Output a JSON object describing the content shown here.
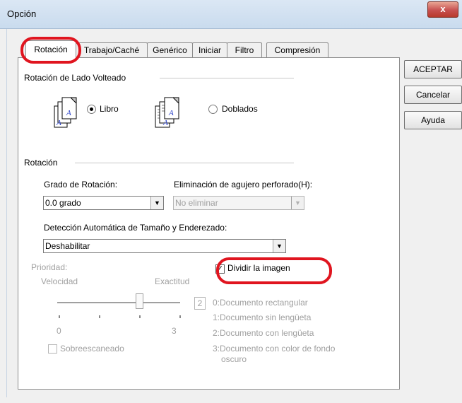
{
  "window": {
    "title": "Opción",
    "close_glyph": "x"
  },
  "tabs": [
    {
      "label": "Rotación",
      "active": true
    },
    {
      "label": "Trabajo/Caché",
      "active": false
    },
    {
      "label": "Genérico",
      "active": false
    },
    {
      "label": "Iniciar",
      "active": false
    },
    {
      "label": "Filtro",
      "active": false
    },
    {
      "label": "Compresión",
      "active": false
    }
  ],
  "buttons": {
    "ok": "ACEPTAR",
    "cancel": "Cancelar",
    "help": "Ayuda"
  },
  "flip_group": {
    "title": "Rotación de Lado Volteado",
    "book_label": "Libro",
    "folded_label": "Doblados",
    "selected": "book"
  },
  "rotation_group": {
    "title": "Rotación",
    "degree_label": "Grado de Rotación:",
    "degree_value": "0.0 grado",
    "punch_label": "Eliminación de agujero perforado(H):",
    "punch_value": "No eliminar",
    "autosize_label": "Detección Automática de Tamaño y Enderezado:",
    "autosize_value": "Deshabilitar",
    "split_label": "Dividir la imagen",
    "split_checked": true,
    "priority_label": "Prioridad:",
    "speed_label": "Velocidad",
    "accuracy_label": "Exactitud",
    "slider_value": "2",
    "slider_min": "0",
    "slider_max": "3",
    "slider_level": 2,
    "doc_types": [
      "0:Documento rectangular",
      "1:Documento sin lengüeta",
      "2:Documento con lengüeta",
      "3:Documento con color de fondo",
      "oscuro"
    ],
    "overscan_label": "Sobreescaneado",
    "overscan_checked": false
  },
  "colors": {
    "highlight": "#e0151f",
    "disabled_text": "#a0a0a0"
  },
  "icons": {
    "book": "book-document-icon",
    "folded": "folded-document-icon",
    "dropdown": "chevron-down-icon"
  }
}
